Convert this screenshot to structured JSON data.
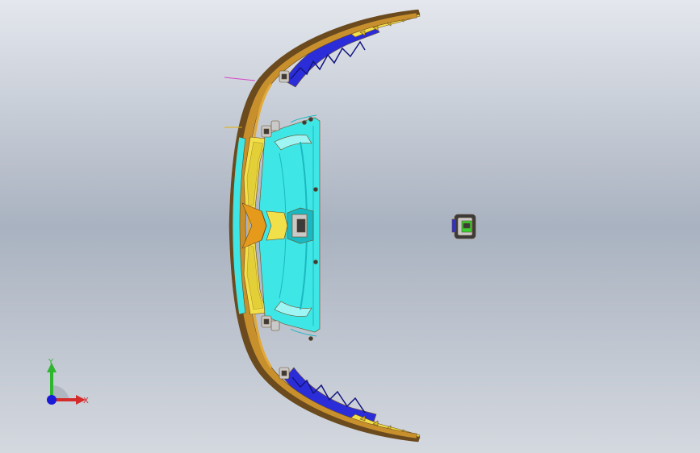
{
  "viewport": {
    "background": {
      "top": "#e4e7ed",
      "middle": "#a9b2c0",
      "bottom": "#d4d8df"
    }
  },
  "model": {
    "colors": {
      "outer_edge": "#6b4a1e",
      "bumper_band": "#c8902d",
      "bumper_inner": "#e0a93a",
      "yellow_panel": "#f2e04a",
      "yellow_dark": "#d6bf28",
      "cyan_body": "#3fe6e6",
      "cyan_light": "#9ff4f4",
      "cyan_dark": "#1bb8c2",
      "blue_trim": "#2b2ed8",
      "blue_dark": "#14157e",
      "clip_gray": "#c9c9c9",
      "clip_dark": "#3b3b3b",
      "green_part": "#33d133",
      "orange_mark": "#e69a1c"
    }
  },
  "coordinate_triad": {
    "x_label": "X",
    "y_label": "Y",
    "x_color": "#d52a2a",
    "y_color": "#2fb52f",
    "z_color": "#2a2ad5",
    "origin_color": "#1a1ad8"
  }
}
